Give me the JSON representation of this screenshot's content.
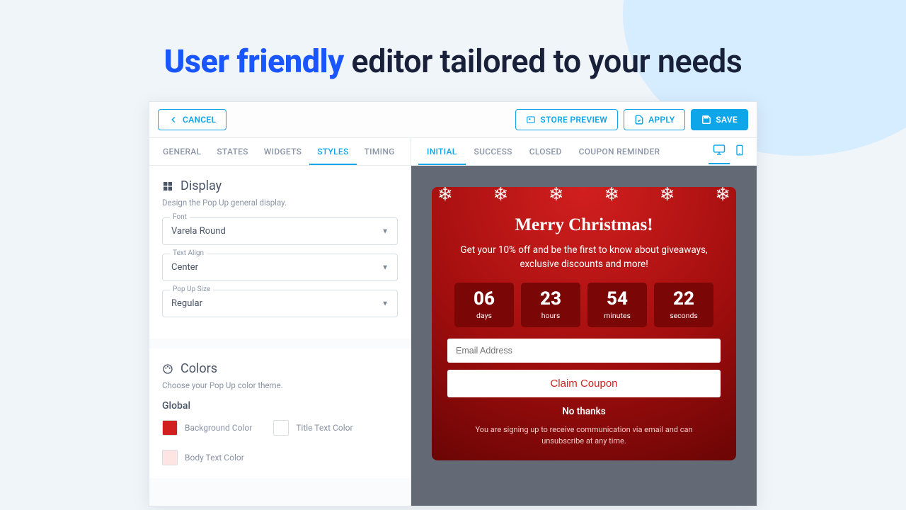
{
  "headline": {
    "accent": "User friendly",
    "rest": " editor tailored to your needs"
  },
  "toolbar": {
    "cancel": "CANCEL",
    "store_preview": "STORE PREVIEW",
    "apply": "APPLY",
    "save": "SAVE"
  },
  "left_tabs": [
    "GENERAL",
    "STATES",
    "WIDGETS",
    "STYLES",
    "TIMING"
  ],
  "left_tab_active": 3,
  "right_tabs": [
    "INITIAL",
    "SUCCESS",
    "CLOSED",
    "COUPON REMINDER"
  ],
  "right_tab_active": 0,
  "display": {
    "title": "Display",
    "sub": "Design the Pop Up general display.",
    "fields": [
      {
        "label": "Font",
        "value": "Varela Round"
      },
      {
        "label": "Text Align",
        "value": "Center"
      },
      {
        "label": "Pop Up Size",
        "value": "Regular"
      }
    ]
  },
  "colors": {
    "title": "Colors",
    "sub": "Choose your Pop Up color theme.",
    "group": "Global",
    "items": [
      {
        "label": "Background Color",
        "hex": "#d21f1f"
      },
      {
        "label": "Title Text Color",
        "hex": "#ffffff"
      },
      {
        "label": "Body Text Color",
        "hex": "#ffe4e4"
      }
    ]
  },
  "popup": {
    "title": "Merry Christmas!",
    "sub": "Get your 10% off and be the first to know about giveaways, exclusive discounts and more!",
    "count": [
      {
        "n": "06",
        "l": "days"
      },
      {
        "n": "23",
        "l": "hours"
      },
      {
        "n": "54",
        "l": "minutes"
      },
      {
        "n": "22",
        "l": "seconds"
      }
    ],
    "email_placeholder": "Email Address",
    "cta": "Claim Coupon",
    "nothanks": "No thanks",
    "disclaimer": "You are signing up to receive communication via email and can unsubscribe at any time."
  }
}
